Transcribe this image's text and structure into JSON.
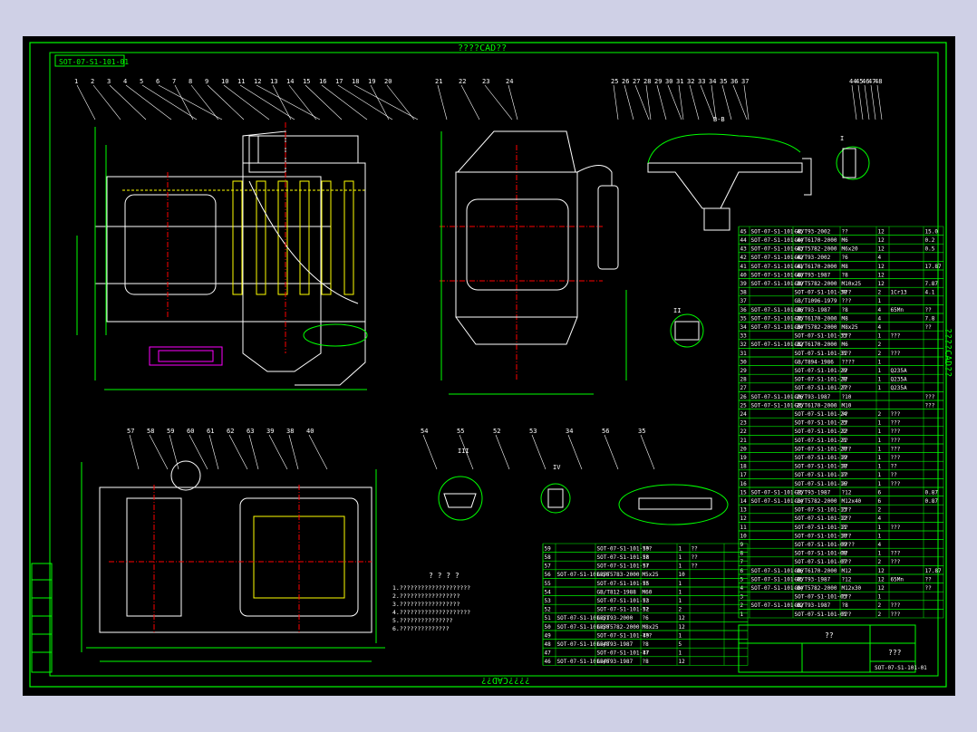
{
  "drawing": {
    "top_title": "????CAD??",
    "bottom_title": "????CAD??",
    "side_title": "????CAD??",
    "code_box": "SOT-07-S1-101-01",
    "notes_title": "? ? ? ?",
    "notes": [
      "1.????????????????????",
      "2.?????????????????",
      "3.?????????????????",
      "4.????????????????????",
      "5.???????????????",
      "6.??????????????"
    ],
    "title_block": {
      "name": "???",
      "company": "??",
      "drawing_no": "SOT-07-S1-101-01"
    },
    "view_labels": [
      "B-B",
      "I",
      "II",
      "III",
      "IV"
    ],
    "callouts_top": [
      "1",
      "2",
      "3",
      "4",
      "5",
      "6",
      "7",
      "8",
      "9",
      "10",
      "11",
      "12",
      "13",
      "14",
      "15",
      "16",
      "17",
      "18",
      "19",
      "20"
    ],
    "callouts_mid": [
      "21",
      "22",
      "23",
      "24"
    ],
    "callouts_right": [
      "25",
      "26",
      "27",
      "28",
      "29",
      "30",
      "31",
      "32",
      "33",
      "34",
      "35",
      "36",
      "37"
    ],
    "callouts_detail": [
      "44",
      "45",
      "46",
      "47",
      "48"
    ],
    "callouts_bottom": [
      "57",
      "58",
      "59",
      "60",
      "61",
      "62",
      "63",
      "39",
      "38",
      "40"
    ],
    "callouts_small": [
      "54",
      "55",
      "52",
      "53",
      "34",
      "56",
      "35"
    ]
  },
  "parts_list": [
    [
      "45",
      "SOT-07-S1-101-45",
      "GB/T93-2002",
      "??",
      "12",
      "",
      "15.0"
    ],
    [
      "44",
      "SOT-07-S1-101-44",
      "GB/T6170-2000",
      "M6",
      "12",
      "",
      "0.2"
    ],
    [
      "43",
      "SOT-07-S1-101-43",
      "GB/T5782-2000",
      "M6x20",
      "12",
      "",
      "0.5"
    ],
    [
      "42",
      "SOT-07-S1-101-42",
      "GB/T93-2002",
      "?6",
      "4",
      "",
      ""
    ],
    [
      "41",
      "SOT-07-S1-101-41",
      "GB/T6170-2000",
      "M8",
      "12",
      "",
      "17.87"
    ],
    [
      "40",
      "SOT-07-S1-101-40",
      "GB/T93-1987",
      "?8",
      "12",
      "",
      ""
    ],
    [
      "39",
      "SOT-07-S1-101-39",
      "GB/T5782-2000",
      "M10x25",
      "12",
      "",
      "7.87"
    ],
    [
      "38",
      "",
      "SOT-07-S1-101-38",
      "???",
      "2",
      "1Cr13",
      "4.1"
    ],
    [
      "37",
      "",
      "GB/T1096-1979",
      "???",
      "1",
      "",
      ""
    ],
    [
      "36",
      "SOT-07-S1-101-36",
      "GB/T93-1987",
      "?8",
      "4",
      "65Mn",
      "??"
    ],
    [
      "35",
      "SOT-07-S1-101-35",
      "GB/T6170-2000",
      "M8",
      "4",
      "",
      "7.8"
    ],
    [
      "34",
      "SOT-07-S1-101-34",
      "GB/T5782-2000",
      "M8x25",
      "4",
      "",
      "??"
    ],
    [
      "33",
      "",
      "SOT-07-S1-101-33",
      "???",
      "1",
      "???",
      ""
    ],
    [
      "32",
      "SOT-07-S1-101-32",
      "GB/T6170-2000",
      "M6",
      "2",
      "",
      ""
    ],
    [
      "31",
      "",
      "SOT-07-S1-101-31",
      "???",
      "2",
      "???",
      ""
    ],
    [
      "30",
      "",
      "GB/T894-1986",
      "????",
      "1",
      "",
      ""
    ],
    [
      "29",
      "",
      "SOT-07-S1-101-29",
      "??",
      "1",
      "Q235A",
      ""
    ],
    [
      "28",
      "",
      "SOT-07-S1-101-28",
      "??",
      "1",
      "Q235A",
      ""
    ],
    [
      "27",
      "",
      "SOT-07-S1-101-27",
      "???",
      "1",
      "Q235A",
      ""
    ],
    [
      "26",
      "SOT-07-S1-101-26",
      "GB/T93-1987",
      "?10",
      "",
      "",
      "???"
    ],
    [
      "25",
      "SOT-07-S1-101-25",
      "GB/T6170-2000",
      "M10",
      "",
      "",
      "???"
    ],
    [
      "24",
      "",
      "SOT-07-S1-101-24",
      "??",
      "2",
      "???",
      ""
    ],
    [
      "23",
      "",
      "SOT-07-S1-101-23",
      "??",
      "1",
      "???",
      ""
    ],
    [
      "22",
      "",
      "SOT-07-S1-101-22",
      "??",
      "1",
      "???",
      ""
    ],
    [
      "21",
      "",
      "SOT-07-S1-101-21",
      "??",
      "1",
      "???",
      ""
    ],
    [
      "20",
      "",
      "SOT-07-S1-101-20",
      "???",
      "1",
      "???",
      ""
    ],
    [
      "19",
      "",
      "SOT-07-S1-101-19",
      "??",
      "1",
      "???",
      ""
    ],
    [
      "18",
      "",
      "SOT-07-S1-101-18",
      "??",
      "1",
      "??",
      ""
    ],
    [
      "17",
      "",
      "SOT-07-S1-101-17",
      "??",
      "1",
      "??",
      ""
    ],
    [
      "16",
      "",
      "SOT-07-S1-101-16",
      "??",
      "1",
      "???",
      ""
    ],
    [
      "15",
      "SOT-07-S1-101-15",
      "GB/T93-1987",
      "?12",
      "6",
      "",
      "0.87"
    ],
    [
      "14",
      "SOT-07-S1-101-14",
      "GB/T5782-2000",
      "M12x40",
      "6",
      "",
      "0.87"
    ],
    [
      "13",
      "",
      "SOT-07-S1-101-13",
      "???",
      "2",
      "",
      ""
    ],
    [
      "12",
      "",
      "SOT-07-S1-101-12",
      "???",
      "4",
      "",
      ""
    ],
    [
      "11",
      "",
      "SOT-07-S1-101-11",
      "??",
      "1",
      "???",
      ""
    ],
    [
      "10",
      "",
      "SOT-07-S1-101-10",
      "???",
      "1",
      "",
      ""
    ],
    [
      "9",
      "",
      "SOT-07-S1-101-09",
      "????",
      "4",
      "",
      ""
    ],
    [
      "8",
      "",
      "SOT-07-S1-101-08",
      "??",
      "1",
      "???",
      ""
    ],
    [
      "7",
      "",
      "SOT-07-S1-101-07",
      "???",
      "2",
      "???",
      ""
    ],
    [
      "6",
      "SOT-07-S1-101-06",
      "GB/T6170-2000",
      "M12",
      "12",
      "",
      "17.87"
    ],
    [
      "5",
      "SOT-07-S1-101-05",
      "GB/T93-1987",
      "?12",
      "12",
      "65Mn",
      "??"
    ],
    [
      "4",
      "SOT-07-S1-101-04",
      "GB/T5782-2000",
      "M12x30",
      "12",
      "",
      "??"
    ],
    [
      "3",
      "",
      "SOT-07-S1-101-03",
      "???",
      "1",
      "",
      ""
    ],
    [
      "2",
      "SOT-07-S1-101-02",
      "GB/T93-1987",
      "?8",
      "2",
      "???",
      ""
    ],
    [
      "1",
      "",
      "SOT-07-S1-101-01",
      "???",
      "2",
      "???",
      ""
    ]
  ],
  "parts_list_lower": [
    [
      "59",
      "",
      "SOT-07-S1-101-59",
      "???",
      "1",
      "??",
      ""
    ],
    [
      "58",
      "",
      "SOT-07-S1-101-58",
      "??",
      "1",
      "??",
      ""
    ],
    [
      "57",
      "",
      "SOT-07-S1-101-57",
      "??",
      "1",
      "??",
      ""
    ],
    [
      "56",
      "SOT-07-S1-101-56",
      "GB/T5783-2000",
      "M5x25",
      "10",
      "",
      ""
    ],
    [
      "55",
      "",
      "SOT-07-S1-101-55",
      "??",
      "1",
      "",
      ""
    ],
    [
      "54",
      "",
      "GB/T812-1988",
      "M60",
      "1",
      "",
      ""
    ],
    [
      "53",
      "",
      "SOT-07-S1-101-53",
      "??",
      "1",
      "",
      ""
    ],
    [
      "52",
      "",
      "SOT-07-S1-101-52",
      "??",
      "2",
      "",
      ""
    ],
    [
      "51",
      "SOT-07-S1-101-51",
      "GB/T93-2000",
      "?6",
      "12",
      "",
      ""
    ],
    [
      "50",
      "SOT-07-S1-101-50",
      "GB/T5782-2000",
      "M8x25",
      "12",
      "",
      ""
    ],
    [
      "49",
      "",
      "SOT-07-S1-101-49",
      "???",
      "1",
      "",
      ""
    ],
    [
      "48",
      "SOT-07-S1-101-48",
      "GB/T93-1987",
      "?8",
      "5",
      "",
      ""
    ],
    [
      "47",
      "",
      "SOT-07-S1-101-47",
      "??",
      "1",
      "",
      ""
    ],
    [
      "46",
      "SOT-07-S1-101-46",
      "GB/T93-1987",
      "?8",
      "12",
      "",
      ""
    ]
  ],
  "colors": {
    "background": "#000000",
    "frame": "#00ff00",
    "outline": "#ffffff",
    "accent_yellow": "#ffff00",
    "accent_red": "#ff0000",
    "accent_magenta": "#ff00ff",
    "accent_cyan": "#00ffff"
  }
}
